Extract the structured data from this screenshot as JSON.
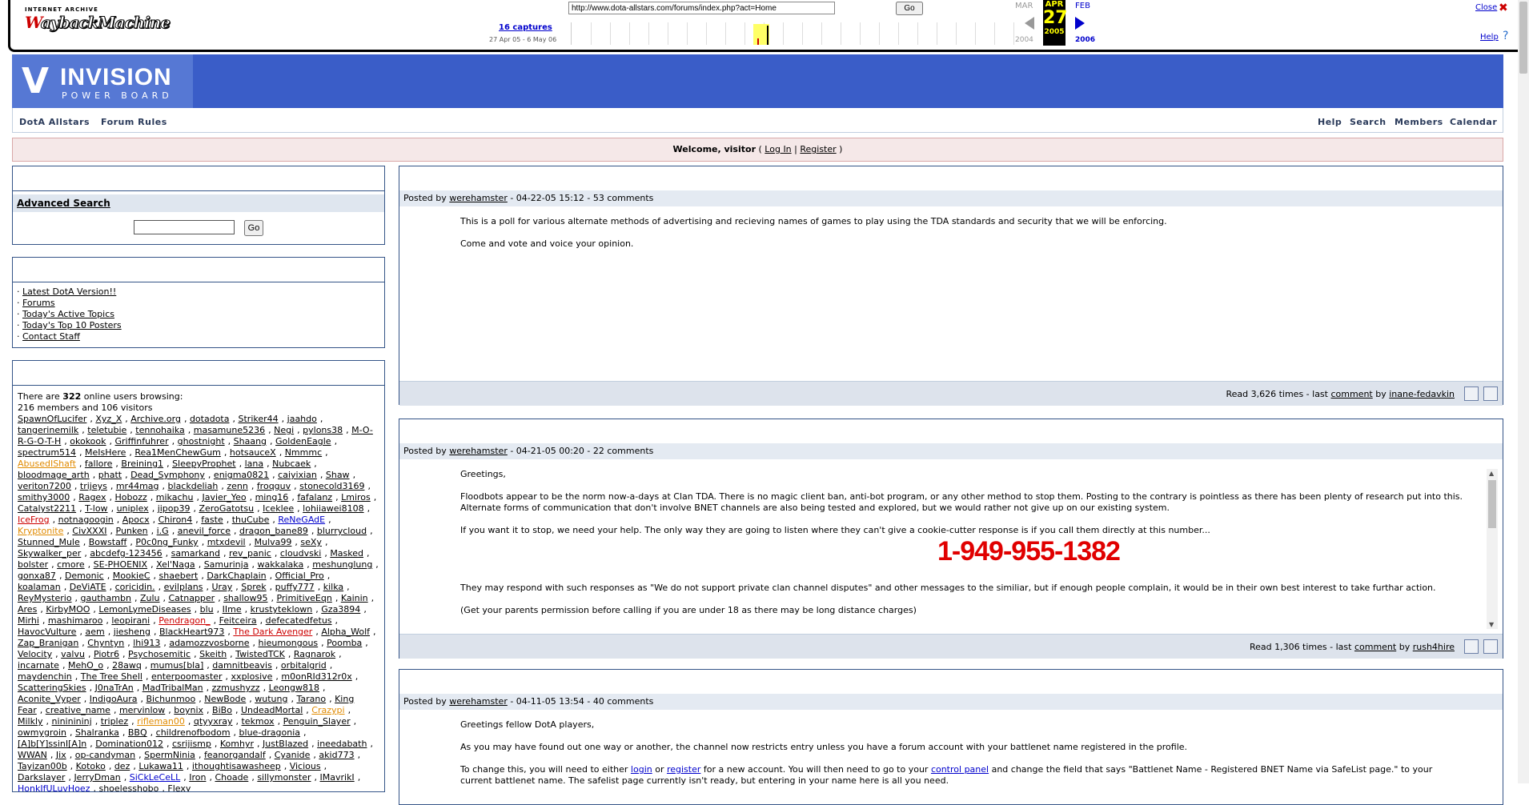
{
  "wayback": {
    "logo_top": "INTERNET ARCHIVE",
    "logo_main": "WaybackMachine",
    "url": "http://www.dota-allstars.com/forums/index.php?act=Home",
    "go": "Go",
    "captures": "16 captures",
    "range": "27 Apr 05 - 6 May 06",
    "prev_month": "MAR",
    "cur_month": "APR",
    "next_month": "FEB",
    "cur_day": "27",
    "prev_year": "2004",
    "cur_year": "2005",
    "next_year": "2006",
    "close": "Close",
    "help": "Help"
  },
  "header": {
    "logo_line1": "INVISION",
    "logo_line2": "POWER BOARD",
    "nav_left": [
      "DotA Allstars",
      "Forum Rules"
    ],
    "nav_right": [
      "Help",
      "Search",
      "Members",
      "Calendar"
    ],
    "welcome_bold": "Welcome, visitor",
    "login": "Log In",
    "register": "Register"
  },
  "sidebar": {
    "advanced_search": "Advanced Search",
    "search_go": "Go",
    "links": [
      "Latest DotA Version!!",
      "Forums",
      "Today's Active Topics",
      "Today's Top 10 Posters",
      "Contact Staff"
    ],
    "online_intro1": "There are ",
    "online_count": "322",
    "online_intro2": " online users browsing:",
    "online_breakdown": "216 members and 106 visitors",
    "users": [
      "SpawnOfLucifer",
      "Xyz_X",
      "Archive.org",
      "dotadota",
      "Striker44",
      "jaahdo",
      "tangerinemilk",
      "teletubie",
      "tennohaika",
      "masamune5236",
      "Negi",
      "pylons38",
      "M-O-R-G-O-T-H",
      "okokook",
      "Griffinfuhrer",
      "ghostnight",
      "Shaang",
      "GoldenEagle",
      "spectrum514",
      "MeIsHere",
      "Rea1MenChewGum",
      "hotsauceX",
      "Nmmmc",
      "AbusedIShaft",
      "fallore",
      "Breining1",
      "SleepyProphet",
      "lana",
      "Nubcaek",
      "bloodmage_arth",
      "phatt",
      "Dead_Symphony",
      "enigma0821",
      "caiyixian",
      "Shaw",
      "veriton7200",
      "trijeys",
      "mr44mag",
      "blackdeliah",
      "zenn",
      "froqguv",
      "stonecold3169",
      "smithy3000",
      "Ragex",
      "Hobozz",
      "mikachu",
      "Javier_Yeo",
      "ming16",
      "fafalanz",
      "Lmiros",
      "Catalyst2211",
      "T-low",
      "uniplex",
      "jipop39",
      "ZeroGatotsu",
      "Iceklee",
      "lohiiawei8108",
      "IceFrog",
      "notnagoogin",
      "Apocx",
      "Chiron4",
      "faste",
      "thuCube",
      "ReNeGAdE",
      "Kryptonite",
      "CivXXXI",
      "Punken",
      "i.G",
      "anevil_force",
      "dragon_bane89",
      "blurrycloud",
      "Stunned_Mule",
      "Bowstaff",
      "P0c0ng_Funky",
      "mtxdevil",
      "Mulva99",
      "seXy",
      "Skywalker_per",
      "abcdefg-123456",
      "samarkand",
      "rev_panic",
      "cloudvski",
      "Masked",
      "bolster",
      "cmore",
      "SE-PHOENIX",
      "Xel'Naga",
      "Samurinja",
      "wakkalaka",
      "meshunglung",
      "gonxa87",
      "Demonic",
      "MookieC",
      "shaebert",
      "DarkChaplain",
      "Official_Pro",
      "koalaman",
      "DeViATE",
      "coricidin.",
      "evilplans",
      "Uray",
      "Sprek",
      "puffy777",
      "kilka",
      "ReyMysterio",
      "gauthambn",
      "Zulu",
      "Catnapper",
      "shallow95",
      "PrimitiveEqn",
      "Kainin",
      "Ares",
      "KirbyMOO",
      "LemonLymeDiseases",
      "blu",
      "IIme",
      "krustyteklown",
      "Gza3894",
      "Mirhi",
      "mashimaroo",
      "leopirani",
      "Pendragon_",
      "Feitceira",
      "defecatedfetus",
      "HavocVulture",
      "aem",
      "jiesheng",
      "BlackHeart973",
      "The Dark Avenger",
      "Alpha_Wolf",
      "Zap_Branigan",
      "Chyntyn",
      "lhi913",
      "adamozzvosborne",
      "hieumongous",
      "Poomba",
      "Velocity",
      "valvu",
      "Piotr6",
      "Psychosemitic",
      "Skeith",
      "TwistedTCK",
      "Ragnarok",
      "incarnate",
      "MehO_o",
      "28awq",
      "mumus[bla]",
      "damnitbeavis",
      "orbitalgrid",
      "maydenchin",
      "The Tree Shell",
      "enterpoomaster",
      "xxplosive",
      "m0onRId312r0x",
      "ScatteringSkies",
      "J0naTrAn",
      "MadTribalMan",
      "zzmushyzz",
      "Leongw818",
      "Aconite_Vyper",
      "IndigoAura",
      "Bichunmoo",
      "NewBode",
      "wutung",
      "Tarano",
      "King Fear",
      "creative_name",
      "mervinlow",
      "boynix",
      "BiBo",
      "UndeadMortal",
      "Crazypi",
      "Milkly",
      "nininininj",
      "triplez",
      "rifleman00",
      "qtyyxray",
      "tekmox",
      "Penguin_Slayer",
      "owmygroin",
      "Shalranka",
      "BBQ",
      "childrenofbodom",
      "blue-dragonia",
      "[A]b[Y]ssinI[A]n",
      "Domination012",
      "csrijismp",
      "Komhyr",
      "JustBlazed",
      "ineedabath",
      "WWAN",
      "Jix",
      "op-candyman",
      "SpermNinia",
      "feanorgandalf",
      "Cyanide",
      "akid773",
      "Tayizan00b",
      "Kotoko",
      "dez",
      "Lukawa11",
      "ithoughtisawasheep",
      "Vicious",
      "Darkslayer",
      "JerryDman",
      "SiCkLeCeLL",
      "Iron",
      "Choade",
      "sillymonster",
      "IMavrikI",
      "HonkIfULuvHoez",
      "shoelesshobo",
      "Flexy"
    ],
    "orange_users": [
      "AbusedIShaft",
      "Kryptonite",
      "Crazypi",
      "rifleman00"
    ],
    "red_users": [
      "IceFrog",
      "Pendragon_",
      "The Dark Avenger"
    ],
    "blue_users": [
      "ReNeGAdE",
      "SiCkLeCeLL",
      "HonkIfULuvHoez"
    ]
  },
  "posts": [
    {
      "posted_by": "Posted by ",
      "author": "werehamster",
      "meta": " - 04-22-05 15:12 - 53 comments",
      "lines": [
        "This is a poll for various alternate methods of advertising and recieving names of games to play using the TDA standards and security that we will be enforcing.",
        "Come and vote and voice your opinion."
      ],
      "read": "Read 3,626 times - last ",
      "comment": "comment",
      "by": " by ",
      "last_user": "inane-fedavkin"
    },
    {
      "posted_by": "Posted by ",
      "author": "werehamster",
      "meta": " - 04-21-05 00:20 - 22 comments",
      "lines": [
        "Greetings,",
        "Floodbots appear to be the norm now-a-days at Clan TDA. There is no magic client ban, anti-bot program, or any other method to stop them. Posting to the contrary is pointless as there has been plenty of research put into this. Alternate forms of communication that don't involve BNET channels are also being tested and explored, but we would rather not give up on our existing system.",
        "If you want it to stop, we need your help. The only way they are going to listen where they can't give a cookie-cutter response is if you call them directly at this number...",
        "They may respond with such responses as \"We do not support private clan channel disputes\" and other messages to the similiar, but if enough people complain, it would be in their own best interest to take furthar action.",
        "(Get your parents permission before calling if you are under 18 as there may be long distance charges)"
      ],
      "phone": "1-949-955-1382",
      "read": "Read 1,306 times - last ",
      "comment": "comment",
      "by": " by ",
      "last_user": "rush4hire"
    },
    {
      "posted_by": "Posted by ",
      "author": "werehamster",
      "meta": " - 04-11-05 13:54 - 40 comments",
      "lines": [
        "Greetings fellow DotA players,",
        "As you may have found out one way or another, the channel now restricts entry unless you have a forum account with your battlenet name registered in the profile."
      ],
      "line3_a": "To change this, you will need to either ",
      "line3_login": "login",
      "line3_or": " or ",
      "line3_register": "register",
      "line3_b": " for a new account. You will then need to go to your ",
      "line3_cp": "control panel",
      "line3_c": " and change the field that says \"Battlenet Name - Registered BNET Name via SafeList page.\" to your",
      "line4": "current battlenet name. The safelist page currently isn't ready, but entering in your name here is all you need."
    }
  ]
}
